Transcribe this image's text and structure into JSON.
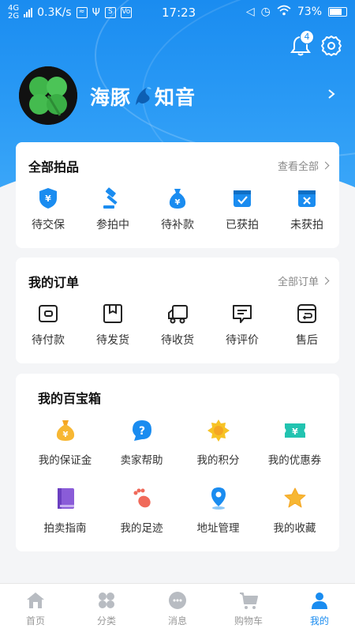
{
  "status_bar": {
    "network_top": "4G",
    "network_bottom": "2G",
    "speed": "0.3K/s",
    "time": "17:23",
    "battery": "73%"
  },
  "header": {
    "notification_count": "4",
    "username_left": "海豚",
    "username_right": "知音"
  },
  "auction_card": {
    "title": "全部拍品",
    "link": "查看全部",
    "items": [
      {
        "label": "待交保",
        "icon": "shield-yen-icon"
      },
      {
        "label": "参拍中",
        "icon": "gavel-icon"
      },
      {
        "label": "待补款",
        "icon": "money-bag-icon"
      },
      {
        "label": "已获拍",
        "icon": "box-check-icon"
      },
      {
        "label": "未获拍",
        "icon": "box-x-icon"
      }
    ]
  },
  "order_card": {
    "title": "我的订单",
    "link": "全部订单",
    "items": [
      {
        "label": "待付款",
        "icon": "wallet-icon"
      },
      {
        "label": "待发货",
        "icon": "package-icon"
      },
      {
        "label": "待收货",
        "icon": "truck-icon"
      },
      {
        "label": "待评价",
        "icon": "comment-icon"
      },
      {
        "label": "售后",
        "icon": "return-icon"
      }
    ]
  },
  "toolbox_card": {
    "title": "我的百宝箱",
    "items": [
      {
        "label": "我的保证金",
        "icon": "deposit-bag-icon"
      },
      {
        "label": "卖家帮助",
        "icon": "help-icon"
      },
      {
        "label": "我的积分",
        "icon": "points-sun-icon"
      },
      {
        "label": "我的优惠券",
        "icon": "coupon-icon"
      },
      {
        "label": "拍卖指南",
        "icon": "guide-book-icon"
      },
      {
        "label": "我的足迹",
        "icon": "footprint-icon"
      },
      {
        "label": "地址管理",
        "icon": "location-pin-icon"
      },
      {
        "label": "我的收藏",
        "icon": "star-icon"
      }
    ]
  },
  "tabbar": {
    "items": [
      {
        "label": "首页",
        "icon": "home-icon"
      },
      {
        "label": "分类",
        "icon": "category-icon"
      },
      {
        "label": "消息",
        "icon": "message-icon"
      },
      {
        "label": "购物车",
        "icon": "cart-icon"
      },
      {
        "label": "我的",
        "icon": "profile-icon",
        "active": true
      }
    ]
  },
  "colors": {
    "primary": "#1a8cf0",
    "orange": "#f5a623",
    "teal": "#22c3b0",
    "purple": "#8a5cd8",
    "red": "#f06a5a"
  }
}
